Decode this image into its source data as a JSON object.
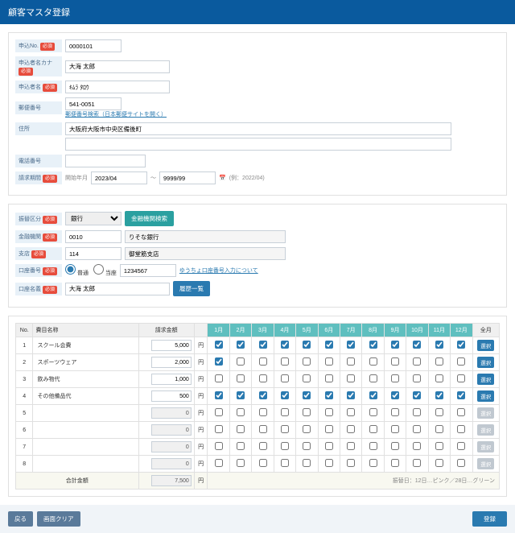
{
  "header": {
    "title": "顧客マスタ登録"
  },
  "ui": {
    "req": "必須",
    "yen": "円"
  },
  "f": {
    "appNo": {
      "label": "申込No.",
      "value": "0000101"
    },
    "kana": {
      "label": "申込者名カナ",
      "value": "大海 太郎"
    },
    "name": {
      "label": "申込者名",
      "value": "ｷﾑﾗ ﾀﾛｳ"
    },
    "zip": {
      "label": "郵便番号",
      "value": "541-0051",
      "link": "郵便番号検索（日本郵便サイトを開く）"
    },
    "addr": {
      "label": "住所",
      "value": "大阪府大阪市中央区備後町"
    },
    "tel": {
      "label": "電話番号"
    },
    "period": {
      "label": "請求期間",
      "startLbl": "開始年月",
      "from": "2023/04",
      "to": "9999/99",
      "hint": "(例：2022/04)"
    }
  },
  "b": {
    "type": {
      "label": "振替区分",
      "value": "銀行"
    },
    "searchBtn": "金融機関検索",
    "bank": {
      "label": "金融機関",
      "code": "0010",
      "name": "りそな銀行"
    },
    "branch": {
      "label": "支店",
      "code": "114",
      "name": "御堂筋支店"
    },
    "acct": {
      "label": "口座番号",
      "opt1": "普通",
      "opt2": "当座",
      "num": "1234567",
      "link": "ゆうちょ口座番号入力について"
    },
    "holder": {
      "label": "口座名義",
      "value": "大海 太郎"
    },
    "histBtn": "履歴一覧"
  },
  "t": {
    "cols": [
      "No.",
      "費目名称",
      "請求金額",
      "",
      "1月",
      "2月",
      "3月",
      "4月",
      "5月",
      "6月",
      "7月",
      "8月",
      "9月",
      "10月",
      "11月",
      "12月",
      "全月"
    ],
    "rows": [
      {
        "no": 1,
        "name": "スクール会費",
        "amt": "5,000",
        "chk": [
          1,
          1,
          1,
          1,
          1,
          1,
          1,
          1,
          1,
          1,
          1,
          1
        ],
        "en": true
      },
      {
        "no": 2,
        "name": "スポーツウェア",
        "amt": "2,000",
        "chk": [
          1,
          0,
          0,
          0,
          0,
          0,
          0,
          0,
          0,
          0,
          0,
          0
        ],
        "en": true
      },
      {
        "no": 3,
        "name": "飲み物代",
        "amt": "1,000",
        "chk": [
          0,
          0,
          0,
          0,
          0,
          0,
          0,
          0,
          0,
          0,
          0,
          0
        ],
        "en": true
      },
      {
        "no": 4,
        "name": "その他備品代",
        "amt": "500",
        "chk": [
          1,
          1,
          1,
          1,
          1,
          1,
          1,
          1,
          1,
          1,
          1,
          1
        ],
        "en": true
      },
      {
        "no": 5,
        "name": "",
        "amt": "0",
        "chk": [
          0,
          0,
          0,
          0,
          0,
          0,
          0,
          0,
          0,
          0,
          0,
          0
        ],
        "en": false
      },
      {
        "no": 6,
        "name": "",
        "amt": "0",
        "chk": [
          0,
          0,
          0,
          0,
          0,
          0,
          0,
          0,
          0,
          0,
          0,
          0
        ],
        "en": false
      },
      {
        "no": 7,
        "name": "",
        "amt": "0",
        "chk": [
          0,
          0,
          0,
          0,
          0,
          0,
          0,
          0,
          0,
          0,
          0,
          0
        ],
        "en": false
      },
      {
        "no": 8,
        "name": "",
        "amt": "0",
        "chk": [
          0,
          0,
          0,
          0,
          0,
          0,
          0,
          0,
          0,
          0,
          0,
          0
        ],
        "en": false
      }
    ],
    "totalLbl": "合計金額",
    "total": "7,500",
    "note": "振替日：12日…ピンク／28日…グリーン",
    "selBtn": "選択"
  },
  "ft": {
    "back": "戻る",
    "clear": "画面クリア",
    "register": "登録"
  }
}
